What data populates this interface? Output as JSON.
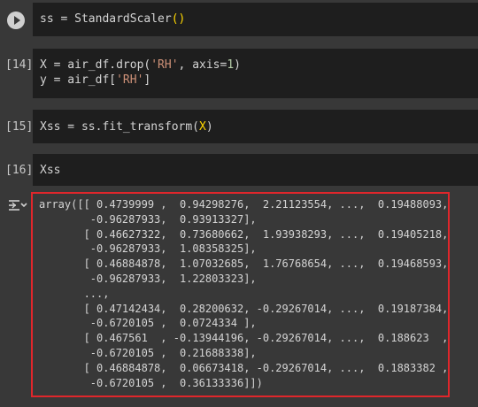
{
  "cells": [
    {
      "prompt": "",
      "code_plain": "ss = StandardScaler",
      "paren": "()"
    },
    {
      "prompt": "[14]",
      "line1_a": "X = air_df.drop(",
      "line1_str": "'RH'",
      "line1_b": ", axis=",
      "line1_num": "1",
      "line1_c": ")",
      "line2_a": "y = air_df[",
      "line2_str": "'RH'",
      "line2_b": "]"
    },
    {
      "prompt": "[15]",
      "code_a": "Xss = ss.fit_transform(",
      "code_b": "X",
      "code_c": ")"
    },
    {
      "prompt": "[16]",
      "code": "Xss"
    }
  ],
  "output": {
    "lines": [
      "array([[ 0.4739999 ,  0.94298276,  2.21123554, ...,  0.19488093,",
      "        -0.96287933,  0.93913327],",
      "       [ 0.46627322,  0.73680662,  1.93938293, ...,  0.19405218,",
      "        -0.96287933,  1.08358325],",
      "       [ 0.46884878,  1.07032685,  1.76768654, ...,  0.19468593,",
      "        -0.96287933,  1.22803323],",
      "       ...,",
      "       [ 0.47142434,  0.28200632, -0.29267014, ...,  0.19187384,",
      "        -0.6720105 ,  0.0724334 ],",
      "       [ 0.467561  , -0.13944196, -0.29267014, ...,  0.188623  ,",
      "        -0.6720105 ,  0.21688338],",
      "       [ 0.46884878,  0.06673418, -0.29267014, ...,  0.1883382 ,",
      "        -0.6720105 ,  0.36133336]])"
    ]
  }
}
